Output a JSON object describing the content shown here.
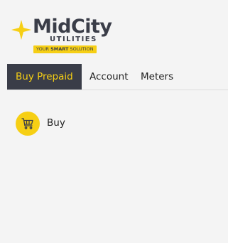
{
  "brand": {
    "name": "MidCity",
    "sub": "UTILITIES",
    "tagline_prefix": "YOUR ",
    "tagline_bold": "SMART",
    "tagline_suffix": " SOLUTION",
    "logo_icon": "four-point-star-icon",
    "colors": {
      "primary": "#3a3d48",
      "accent": "#f6cf14"
    }
  },
  "tabs": [
    {
      "label": "Buy Prepaid",
      "active": true
    },
    {
      "label": "Account",
      "active": false
    },
    {
      "label": "Meters",
      "active": false
    }
  ],
  "actions": [
    {
      "label": "Buy",
      "icon": "shopping-cart-icon"
    }
  ]
}
